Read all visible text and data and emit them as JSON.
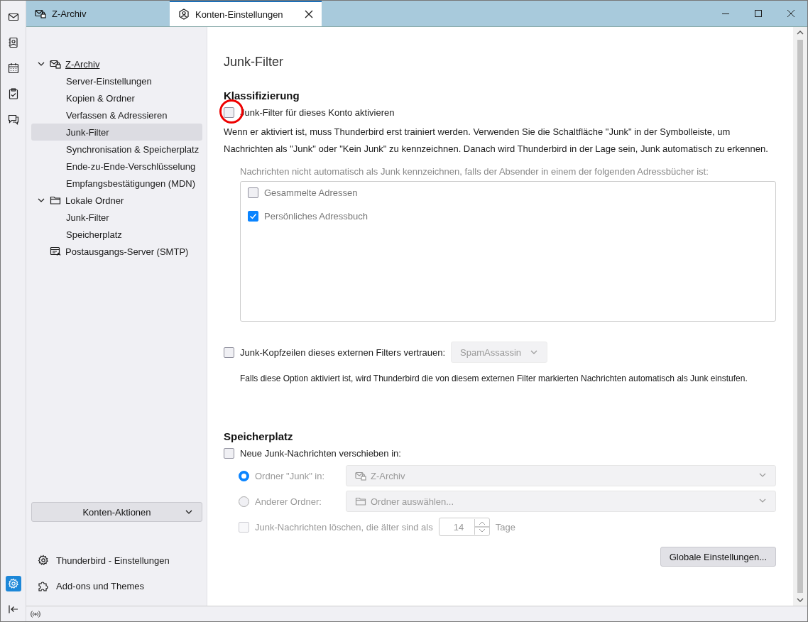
{
  "spaces_toolbar": {
    "top": [
      {
        "kind": "mail",
        "selected": false
      },
      {
        "kind": "address-book",
        "selected": false
      },
      {
        "kind": "calendar",
        "selected": false
      },
      {
        "kind": "tasks",
        "selected": false
      },
      {
        "kind": "chat",
        "selected": false
      }
    ],
    "bottom": [
      {
        "kind": "settings",
        "selected": true
      },
      {
        "kind": "collapse",
        "selected": false
      }
    ]
  },
  "tabs": [
    {
      "label": "Z-Archiv",
      "kind": "mail-account",
      "selected": false
    },
    {
      "label": "Konten-Einstellungen",
      "kind": "account-settings",
      "selected": true
    }
  ],
  "sidebar": {
    "tree": [
      {
        "label": "Z-Archiv",
        "kind": "mail-account",
        "expanded": true,
        "selected": false,
        "children": [
          {
            "label": "Server-Einstellungen",
            "selected": false
          },
          {
            "label": "Kopien & Ordner",
            "selected": false
          },
          {
            "label": "Verfassen & Adressieren",
            "selected": false
          },
          {
            "label": "Junk-Filter",
            "selected": true
          },
          {
            "label": "Synchronisation & Speicherplatz",
            "selected": false
          },
          {
            "label": "Ende-zu-Ende-Verschlüsselung",
            "selected": false
          },
          {
            "label": "Empfangsbestätigungen (MDN)",
            "selected": false
          }
        ]
      },
      {
        "label": "Lokale Ordner",
        "kind": "folder",
        "expanded": true,
        "selected": false,
        "children": [
          {
            "label": "Junk-Filter",
            "selected": false
          },
          {
            "label": "Speicherplatz",
            "selected": false
          }
        ]
      },
      {
        "label": "Postausgangs-Server (SMTP)",
        "kind": "outgoing-server",
        "selected": false
      }
    ],
    "actions_button": "Konten-Aktionen",
    "footer_links": [
      {
        "kind": "settings",
        "label": "Thunderbird - Einstellungen"
      },
      {
        "kind": "addons",
        "label": "Add-ons und Themes"
      }
    ]
  },
  "content": {
    "title": "Junk-Filter",
    "classification": {
      "heading": "Klassifizierung",
      "enable": {
        "label": "Junk-Filter für dieses Konto aktivieren",
        "checked": false,
        "highlighted": true
      },
      "description": "Wenn er aktiviert ist, muss Thunderbird erst trainiert werden. Verwenden Sie die Schaltfläche \"Junk\" in der Symbolleiste, um Nachrichten als \"Junk\" oder \"Kein Junk\" zu kennzeichnen. Danach wird Thunderbird in der Lage sein, Junk automatisch zu erkennen.",
      "whitelist": {
        "label": "Nachrichten nicht automatisch als Junk kennzeichnen, falls der Absender in einem der folgenden Adressbücher ist:",
        "disabled": true,
        "books": [
          {
            "label": "Gesammelte Adressen",
            "checked": false
          },
          {
            "label": "Persönliches Adressbuch",
            "checked": true
          }
        ]
      },
      "trust_headers": {
        "label": "Junk-Kopfzeilen dieses externen Filters vertrauen:",
        "checked": false,
        "filter": "SpamAssassin",
        "note": "Falls diese Option aktiviert ist, wird Thunderbird die von diesem externen Filter markierten Nachrichten automatisch als Junk einstufen."
      }
    },
    "storage": {
      "heading": "Speicherplatz",
      "move": {
        "label": "Neue Junk-Nachrichten verschieben in:",
        "checked": false
      },
      "targets": [
        {
          "label": "Ordner \"Junk\" in:",
          "selected": true,
          "disabled": true,
          "kind": "mail-account",
          "value": "Z-Archiv"
        },
        {
          "label": "Anderer Ordner:",
          "selected": false,
          "disabled": true,
          "kind": "folder",
          "value": "Ordner auswählen..."
        }
      ],
      "purge": {
        "label": "Junk-Nachrichten löschen, die älter sind als",
        "checked": false,
        "disabled": true,
        "days": "14",
        "unit": "Tage"
      },
      "global_button": "Globale Einstellungen..."
    }
  }
}
